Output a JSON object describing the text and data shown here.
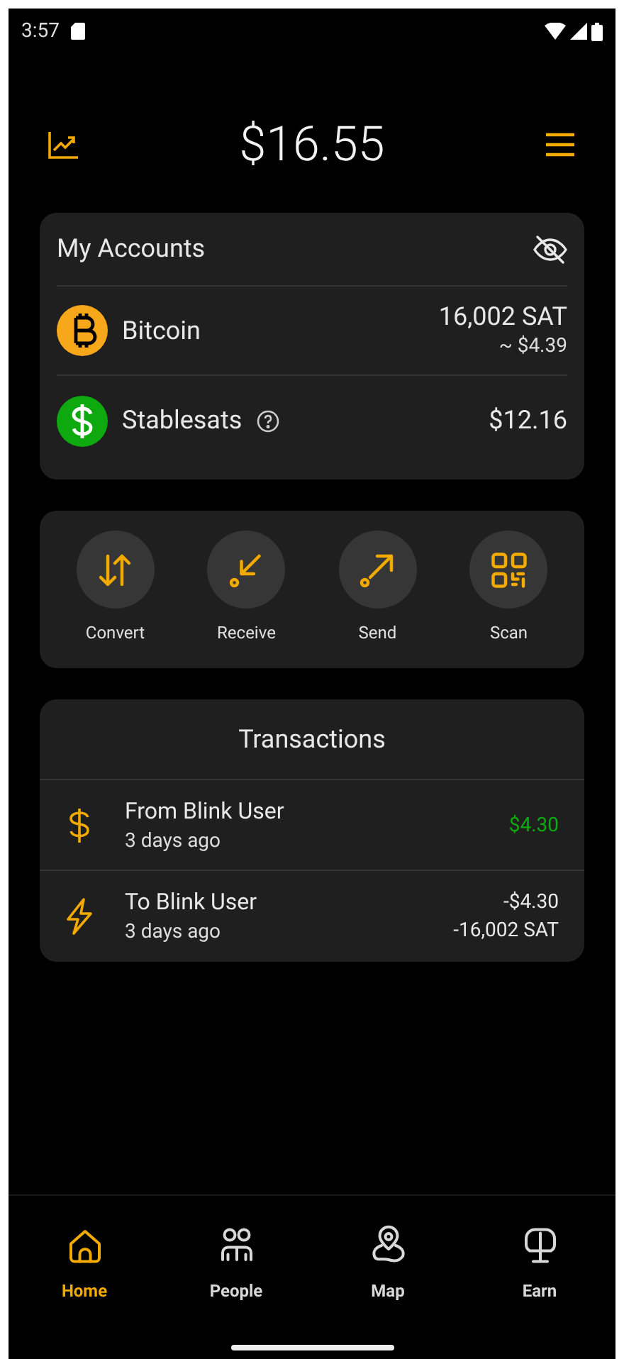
{
  "status_bar": {
    "time": "3:57"
  },
  "header": {
    "balance": "$16.55"
  },
  "accounts": {
    "title": "My Accounts",
    "items": [
      {
        "kind": "bitcoin",
        "name": "Bitcoin",
        "color": "#f7a71a",
        "primary": "16,002 SAT",
        "secondary": "~ $4.39",
        "help": false
      },
      {
        "kind": "dollar",
        "name": "Stablesats",
        "color": "#0ea90e",
        "primary": "$12.16",
        "help": true
      }
    ]
  },
  "actions": [
    {
      "kind": "convert",
      "label": "Convert"
    },
    {
      "kind": "receive",
      "label": "Receive"
    },
    {
      "kind": "send",
      "label": "Send"
    },
    {
      "kind": "scan",
      "label": "Scan"
    }
  ],
  "transactions": {
    "title": "Transactions",
    "items": [
      {
        "kind": "received",
        "title": "From Blink User",
        "time": "3 days ago",
        "amounts": [
          "$4.30"
        ]
      },
      {
        "kind": "sent",
        "title": "To Blink User",
        "time": "3 days ago",
        "amounts": [
          "-$4.30",
          "-16,002 SAT"
        ]
      }
    ]
  },
  "nav": [
    {
      "kind": "home",
      "label": "Home",
      "selected": true
    },
    {
      "kind": "people",
      "label": "People",
      "selected": false
    },
    {
      "kind": "map",
      "label": "Map",
      "selected": false
    },
    {
      "kind": "earn",
      "label": "Earn",
      "selected": false
    }
  ]
}
